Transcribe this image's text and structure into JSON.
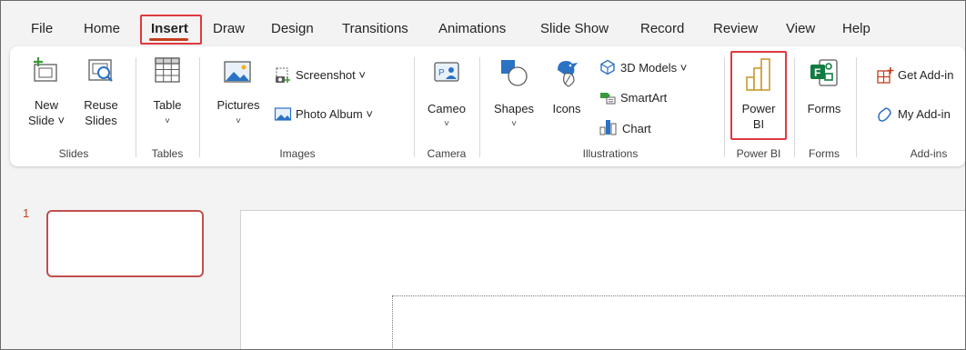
{
  "tabs": [
    "File",
    "Home",
    "Insert",
    "Draw",
    "Design",
    "Transitions",
    "Animations",
    "Slide Show",
    "Record",
    "Review",
    "View",
    "Help"
  ],
  "active_tab": "Insert",
  "accent_color": "#c43e1c",
  "highlight_color": "#e0383e",
  "ribbon": {
    "slides": {
      "label": "Slides",
      "new_slide_1": "New",
      "new_slide_2": "Slide ˅",
      "reuse_1": "Reuse",
      "reuse_2": "Slides",
      "icons": [
        "new-slide-icon",
        "reuse-slides-icon"
      ]
    },
    "tables": {
      "label": "Tables",
      "table": "Table",
      "chev": "˅",
      "icons": [
        "table-icon"
      ]
    },
    "images": {
      "label": "Images",
      "pictures": "Pictures",
      "chev": "˅",
      "screenshot": "Screenshot ˅",
      "photo_album": "Photo Album  ˅",
      "icons": [
        "pictures-icon",
        "screenshot-icon",
        "photo-album-icon"
      ]
    },
    "camera": {
      "label": "Camera",
      "cameo": "Cameo",
      "chev": "˅",
      "icons": [
        "cameo-icon"
      ]
    },
    "illustrations": {
      "label": "Illustrations",
      "shapes": "Shapes",
      "shapes_chev": "˅",
      "icons_btn": "Icons",
      "models": "3D Models  ˅",
      "smartart": "SmartArt",
      "chart": "Chart",
      "icons": [
        "shapes-icon",
        "icons-icon",
        "3d-models-icon",
        "smartart-icon",
        "chart-icon"
      ]
    },
    "powerbi": {
      "label": "Power BI",
      "line1": "Power",
      "line2": "BI",
      "icons": [
        "power-bi-icon"
      ]
    },
    "forms": {
      "label": "Forms",
      "forms": "Forms",
      "icons": [
        "forms-icon"
      ]
    },
    "addins": {
      "label": "Add-ins",
      "get": "Get Add-in",
      "my": "My Add-in",
      "icons": [
        "get-add-ins-icon",
        "my-add-ins-icon"
      ]
    }
  },
  "slide_panel": {
    "slide_number": "1"
  }
}
